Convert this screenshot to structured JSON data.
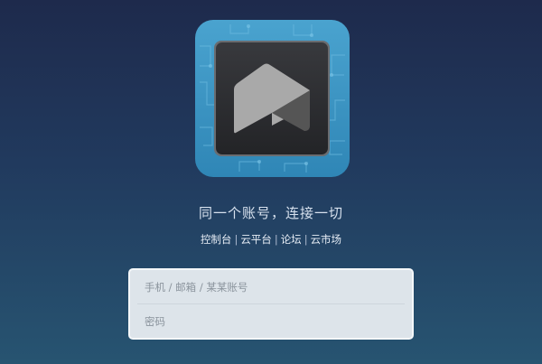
{
  "logo": {
    "icon": "app-logo-icon",
    "colors": {
      "outer": "#3f97c4",
      "inner": "#2b2d31",
      "shape_light": "#a9a9a9",
      "shape_dark": "#555555"
    }
  },
  "tagline": "同一个账号，连接一切",
  "nav_links": [
    {
      "label": "控制台"
    },
    {
      "label": "云平台"
    },
    {
      "label": "论坛"
    },
    {
      "label": "云市场"
    }
  ],
  "nav_separator": "|",
  "login": {
    "account_placeholder": "手机 / 邮箱 / 某某账号",
    "password_placeholder": "密码"
  }
}
